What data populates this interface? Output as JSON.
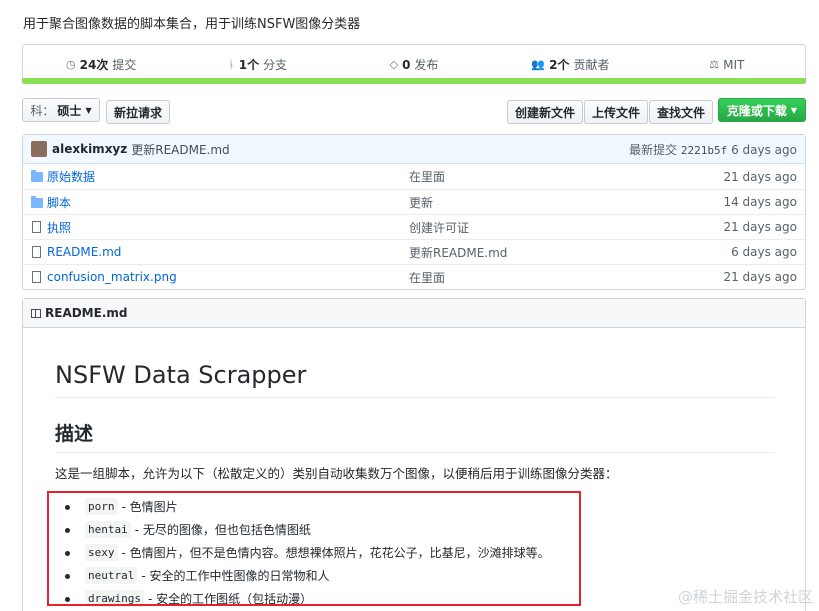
{
  "repo": {
    "description": "用于聚合图像数据的脚本集合，用于训练NSFW图像分类器"
  },
  "summary": {
    "commits_count": "24次",
    "commits_label": "提交",
    "branches_count": "1个",
    "branches_label": "分支",
    "releases_count": "0",
    "releases_label": "发布",
    "contributors_count": "2个",
    "contributors_label": "贡献者",
    "license": "MIT",
    "lang_color": "#89e051"
  },
  "toolbar": {
    "branch_prefix": "科：",
    "branch_name": "硕士",
    "new_pr": "新拉请求",
    "create_file": "创建新文件",
    "upload_file": "上传文件",
    "find_file": "查找文件",
    "clone": "克隆或下载"
  },
  "commit": {
    "author": "alexkimxyz",
    "message": "更新README.md",
    "latest_label": "最新提交",
    "sha": "2221b5f",
    "age": "6 days ago"
  },
  "files": [
    {
      "type": "folder",
      "name": "原始数据",
      "message": "在里面",
      "age": "21 days ago"
    },
    {
      "type": "folder",
      "name": "脚本",
      "message": "更新",
      "age": "14 days ago"
    },
    {
      "type": "file",
      "name": "执照",
      "message": "创建许可证",
      "age": "21 days ago"
    },
    {
      "type": "file",
      "name": "README.md",
      "message": "更新README.md",
      "age": "6 days ago"
    },
    {
      "type": "file",
      "name": "confusion_matrix.png",
      "message": "在里面",
      "age": "21 days ago"
    }
  ],
  "readme": {
    "filename": "README.md",
    "title": "NSFW Data Scrapper",
    "heading": "描述",
    "intro": "这是一组脚本，允许为以下（松散定义的）类别自动收集数万个图像，以便稍后用于训练图像分类器：",
    "categories": [
      {
        "code": "porn",
        "text": "- 色情图片"
      },
      {
        "code": "hentai",
        "text": "- 无尽的图像，但也包括色情图纸"
      },
      {
        "code": "sexy",
        "text": "- 色情图片，但不是色情内容。想想裸体照片，花花公子，比基尼，沙滩排球等。"
      },
      {
        "code": "neutral",
        "text": "- 安全的工作中性图像的日常物和人"
      },
      {
        "code": "drawings",
        "text": "- 安全的工作图纸（包括动漫）"
      }
    ]
  },
  "watermark": "@稀土掘金技术社区"
}
